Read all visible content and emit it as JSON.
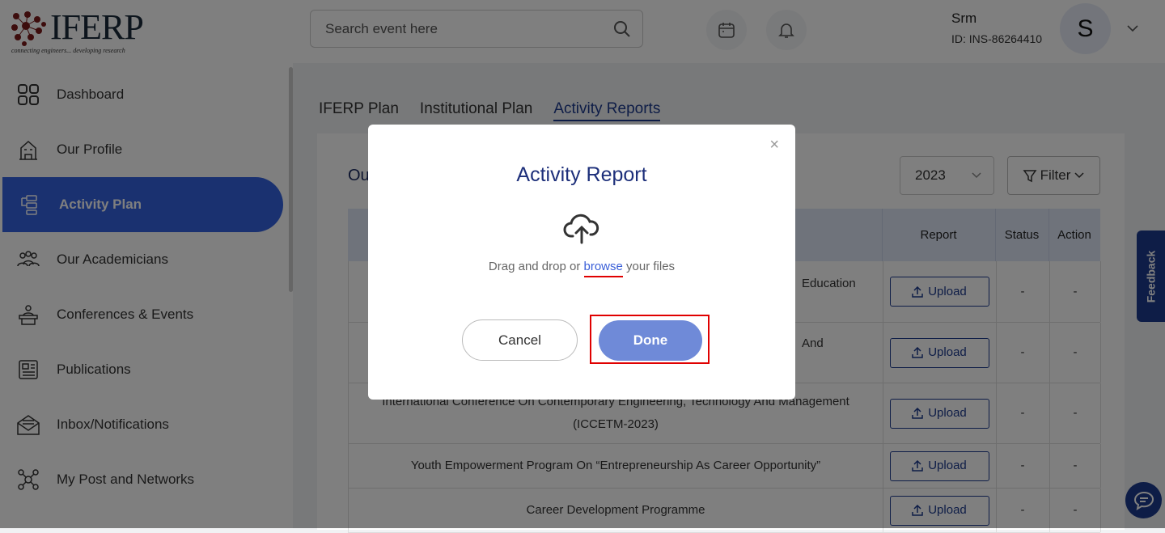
{
  "logo": {
    "word": "IFERP",
    "tagline": "connecting engineers... developing research"
  },
  "sidebar": {
    "items": [
      {
        "label": "Dashboard",
        "icon": "dashboard-icon"
      },
      {
        "label": "Our Profile",
        "icon": "building-icon"
      },
      {
        "label": "Activity Plan",
        "icon": "activity-plan-icon",
        "active": true
      },
      {
        "label": "Our Academicians",
        "icon": "people-icon"
      },
      {
        "label": "Conferences & Events",
        "icon": "presenter-icon"
      },
      {
        "label": "Publications",
        "icon": "newspaper-icon"
      },
      {
        "label": "Inbox/Notifications",
        "icon": "mail-icon"
      },
      {
        "label": "My Post and Networks",
        "icon": "network-icon"
      }
    ]
  },
  "header": {
    "search_placeholder": "Search event here",
    "user_name": "Srm",
    "user_id": "ID: INS-86264410",
    "avatar_letter": "S"
  },
  "tabs": [
    {
      "label": "IFERP Plan"
    },
    {
      "label": "Institutional Plan"
    },
    {
      "label": "Activity Reports",
      "active": true
    }
  ],
  "main": {
    "section_title": "Ou",
    "year": "2023",
    "filter_label": "Filter",
    "columns": {
      "report": "Report",
      "status": "Status",
      "action": "Action"
    },
    "rows": [
      {
        "event": "Education",
        "report": "Upload",
        "status": "-",
        "action": "-"
      },
      {
        "event": "And",
        "report": "Upload",
        "status": "-",
        "action": "-"
      },
      {
        "event": "International Conference On Contemporary Engineering, Technology And Management (ICCETM-2023)",
        "report": "Upload",
        "status": "-",
        "action": "-"
      },
      {
        "event": "Youth Empowerment Program On “Entrepreneurship As Career Opportunity”",
        "report": "Upload",
        "status": "-",
        "action": "-"
      },
      {
        "event": "Career Development Programme",
        "report": "Upload",
        "status": "-",
        "action": "-"
      }
    ]
  },
  "feedback_label": "Feedback",
  "modal": {
    "title": "Activity Report",
    "drop_before": "Drag and drop or ",
    "browse": "browse",
    "drop_after": " your files",
    "cancel": "Cancel",
    "done": "Done",
    "close": "×"
  },
  "colors": {
    "primary": "#1d3a8f",
    "active_nav": "#3463e0",
    "done_button": "#6f8ad8",
    "highlight": "#e00000"
  }
}
